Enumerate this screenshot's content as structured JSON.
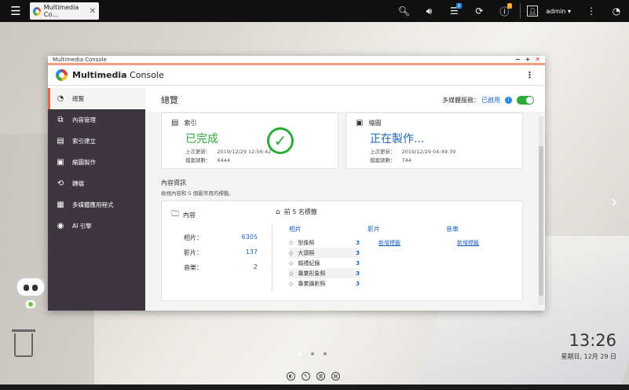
{
  "taskbar": {
    "tab_label": "Multimedia Co...",
    "user": "admin",
    "notif_badge_1": "2",
    "notif_badge_2": "!"
  },
  "window": {
    "titlebar": "Multimedia Console",
    "app_name_bold": "Multimedia",
    "app_name_rest": " Console"
  },
  "sidebar": {
    "items": [
      {
        "label": "總覽",
        "icon": "gauge-icon"
      },
      {
        "label": "內容管理",
        "icon": "content-icon"
      },
      {
        "label": "索引建立",
        "icon": "clipboard-icon"
      },
      {
        "label": "縮圖製作",
        "icon": "image-icon"
      },
      {
        "label": "轉檔",
        "icon": "transcode-icon"
      },
      {
        "label": "多媒體應用程式",
        "icon": "apps-icon"
      },
      {
        "label": "AI 引擎",
        "icon": "ai-icon"
      }
    ]
  },
  "main": {
    "title": "總覽",
    "server_label": "多媒體服務：",
    "server_value": "已啟用",
    "index_card": {
      "title": "索引",
      "status": "已完成",
      "last_update_label": "上次更新：",
      "last_update": "2019/12/29 12:56:42",
      "total_label": "檔案總數：",
      "total": "6444"
    },
    "thumb_card": {
      "title": "縮圖",
      "status": "正在製作...",
      "last_update_label": "上次更新：",
      "last_update": "2019/12/29 04:49:39",
      "total_label": "檔案總數：",
      "total": "744"
    },
    "content_info": {
      "title": "內容資訊",
      "subtitle": "檢視內容和 5 個最常用的標籤。",
      "content_title": "內容",
      "stats": [
        {
          "label": "相片：",
          "value": "6305"
        },
        {
          "label": "影片：",
          "value": "137"
        },
        {
          "label": "音樂：",
          "value": "2"
        }
      ],
      "top_tags_title": "前 5 名標籤",
      "columns": [
        "相片",
        "影片",
        "音樂"
      ],
      "photo_tags": [
        {
          "name": "型像照",
          "count": "3"
        },
        {
          "name": "大頭照",
          "count": "3"
        },
        {
          "name": "婚禮紀錄",
          "count": "3"
        },
        {
          "name": "專業形象照",
          "count": "3"
        },
        {
          "name": "專業攝影照",
          "count": "3"
        }
      ],
      "video_add": "新增標籤",
      "music_add": "新增標籤"
    }
  },
  "desktop": {
    "time": "13:26",
    "date": "星期日, 12月 29 日"
  }
}
